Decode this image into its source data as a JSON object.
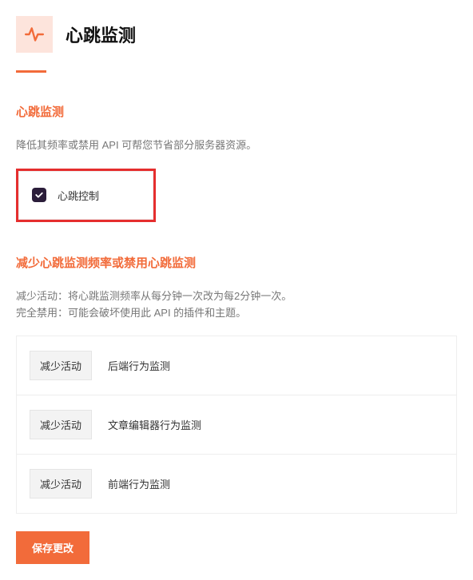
{
  "header": {
    "title": "心跳监测",
    "icon": "heartbeat-icon"
  },
  "section1": {
    "title": "心跳监测",
    "desc": "降低其频率或禁用 API 可帮您节省部分服务器资源。",
    "checkbox_label": "心跳控制"
  },
  "section2": {
    "title": "减少心跳监测频率或禁用心跳监测",
    "desc_line1": "减少活动：将心跳监测频率从每分钟一次改为每2分钟一次。",
    "desc_line2": "完全禁用：可能会破坏使用此 API 的插件和主题。",
    "options": [
      {
        "button": "减少活动",
        "label": "后端行为监测"
      },
      {
        "button": "减少活动",
        "label": "文章编辑器行为监测"
      },
      {
        "button": "减少活动",
        "label": "前端行为监测"
      }
    ]
  },
  "save_button": "保存更改"
}
